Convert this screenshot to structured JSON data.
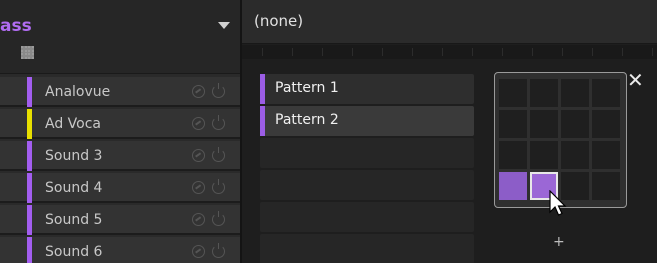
{
  "group": {
    "name": "ass",
    "dropdown_icon": "triangle-down-icon",
    "pad_view_icon": "pad-grid-icon"
  },
  "sounds": [
    {
      "label": "Analovue",
      "color": "#a35ef0"
    },
    {
      "label": "Ad Voca",
      "color": "#e8e000"
    },
    {
      "label": "Sound 3",
      "color": "#a35ef0"
    },
    {
      "label": "Sound 4",
      "color": "#a35ef0"
    },
    {
      "label": "Sound 5",
      "color": "#a35ef0"
    },
    {
      "label": "Sound 6",
      "color": "#a35ef0"
    }
  ],
  "scene": {
    "name": "(none)"
  },
  "patterns": [
    {
      "label": "Pattern 1"
    },
    {
      "label": "Pattern 2"
    }
  ],
  "pattern_bank": {
    "rows": 4,
    "cols": 4,
    "used_cells": [
      [
        3,
        0
      ]
    ],
    "selected_cell": [
      3,
      1
    ],
    "close_icon": "close-icon",
    "close_glyph": "✕",
    "add_glyph": "+"
  },
  "colors": {
    "accent": "#9b5de5",
    "group_text": "#b06cf0"
  }
}
